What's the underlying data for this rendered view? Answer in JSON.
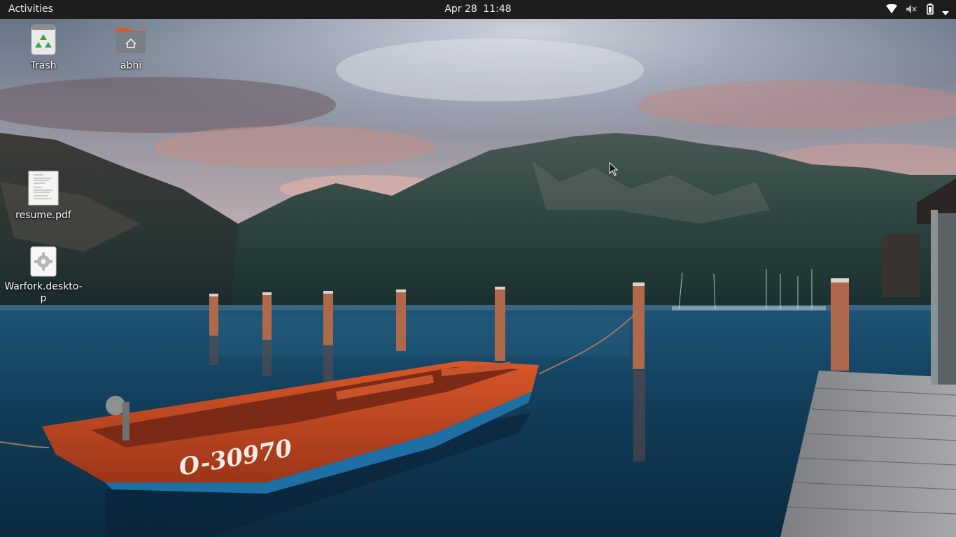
{
  "topbar": {
    "activities_label": "Activities",
    "date": "Apr 28",
    "time": "11:48",
    "tray_icons": [
      "wifi-icon",
      "volume-muted-icon",
      "battery-icon",
      "system-menu-chevron-icon"
    ]
  },
  "desktop": {
    "icons": [
      {
        "name": "trash",
        "label": "Trash",
        "icon": "trash-icon"
      },
      {
        "name": "home-folder",
        "label": "abhi",
        "icon": "home-folder-icon"
      },
      {
        "name": "resume-file",
        "label": "resume.pdf",
        "icon": "pdf-document-icon"
      },
      {
        "name": "warfork-launcher",
        "label": "Warfork.deskto-p",
        "icon": "gear-icon"
      }
    ]
  },
  "wallpaper": {
    "boat_text": "O-30970"
  },
  "colors": {
    "topbar_bg": "#1d1d1d",
    "topbar_text": "#eeeeee",
    "folder_orange": "#e0603a",
    "trash_green": "#3aa643"
  }
}
